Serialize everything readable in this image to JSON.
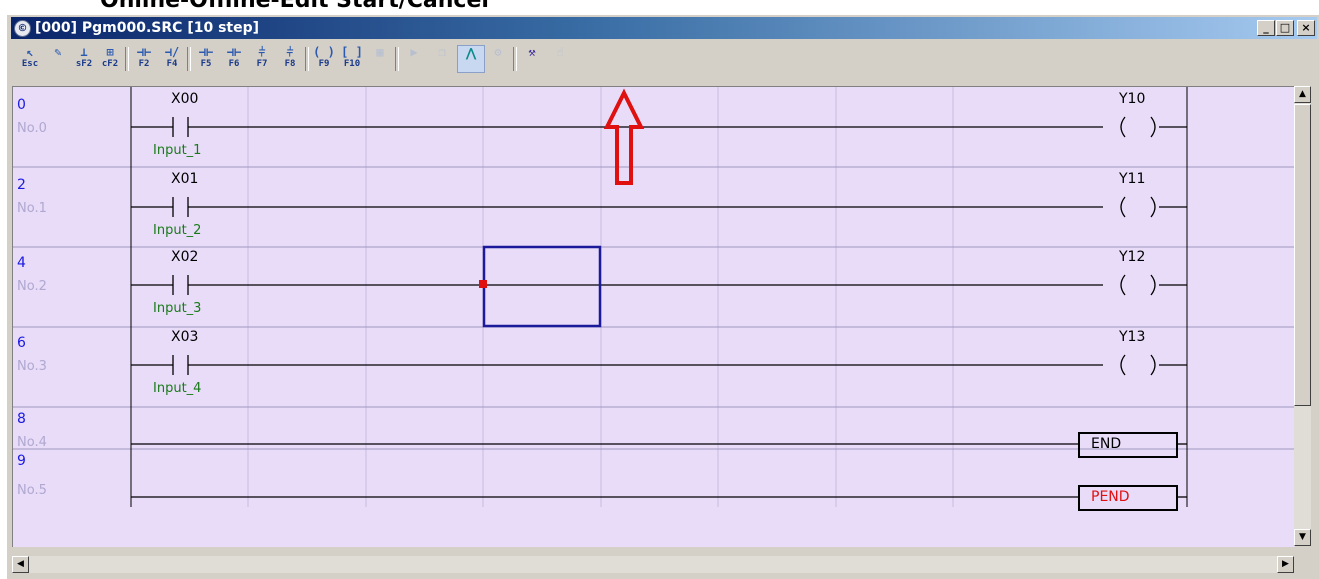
{
  "caption": "Online-Offline-Edit Start/Cancel",
  "window": {
    "title": "[000] Pgm000.SRC [10 step]",
    "icon": "app-icon",
    "controls": [
      "minimize",
      "maximize",
      "close"
    ]
  },
  "toolbar": {
    "buttons": [
      {
        "name": "esc-select-tool",
        "label": "Esc",
        "icon": "arrow-icon"
      },
      {
        "name": "comment-edit-tool",
        "label": "",
        "icon": "pencil-icon"
      },
      {
        "name": "sf2-insert-tool",
        "label": "sF2",
        "icon": "insert-icon"
      },
      {
        "name": "cf2-tool",
        "label": "cF2",
        "icon": "delete-icon"
      },
      {
        "name": "f2-contact-no",
        "label": "F2",
        "icon": "no-contact-icon"
      },
      {
        "name": "f4-contact-nc",
        "label": "F4",
        "icon": "nc-contact-icon"
      },
      {
        "name": "f5-tool",
        "label": "F5",
        "icon": "rising-contact-icon"
      },
      {
        "name": "f6-tool",
        "label": "F6",
        "icon": "falling-contact-icon"
      },
      {
        "name": "f7-tool",
        "label": "F7",
        "icon": "parallel-contact-icon"
      },
      {
        "name": "f8-tool",
        "label": "F8",
        "icon": "parallel-nc-icon"
      },
      {
        "name": "f9-coil",
        "label": "F9",
        "icon": "coil-icon"
      },
      {
        "name": "f10-function",
        "label": "F10",
        "icon": "function-icon"
      },
      {
        "name": "disabled-tool-1",
        "label": "",
        "icon": "grid-icon"
      },
      {
        "name": "disabled-tool-2",
        "label": "",
        "icon": "run-icon"
      },
      {
        "name": "disabled-tool-3",
        "label": "",
        "icon": "copy-icon"
      },
      {
        "name": "online-edit-tool",
        "label": "",
        "icon": "online-edit-icon"
      },
      {
        "name": "disabled-tool-4",
        "label": "",
        "icon": "gear-icon"
      },
      {
        "name": "monitor-tool",
        "label": "",
        "icon": "monitor-icon"
      },
      {
        "name": "disabled-tool-5",
        "label": "",
        "icon": "pointer-icon"
      }
    ]
  },
  "rungs": [
    {
      "step": "0",
      "no": "No.0",
      "contact": "X00",
      "comment": "Input_1",
      "coil": "Y10"
    },
    {
      "step": "2",
      "no": "No.1",
      "contact": "X01",
      "comment": "Input_2",
      "coil": "Y11"
    },
    {
      "step": "4",
      "no": "No.2",
      "contact": "X02",
      "comment": "Input_3",
      "coil": "Y12"
    },
    {
      "step": "6",
      "no": "No.3",
      "contact": "X03",
      "comment": "Input_4",
      "coil": "Y13"
    },
    {
      "step": "8",
      "no": "No.4",
      "box": "END"
    },
    {
      "step": "9",
      "no": "No.5",
      "box": "PEND"
    }
  ],
  "colors": {
    "background": "#e8dcf8",
    "step_number": "#1a1ae0",
    "rung_no": "#b0a8d0",
    "comment": "#1a7a1a",
    "cursor": "#1a1a9a",
    "arrow": "#e01010",
    "pend_text": "#e01010"
  }
}
